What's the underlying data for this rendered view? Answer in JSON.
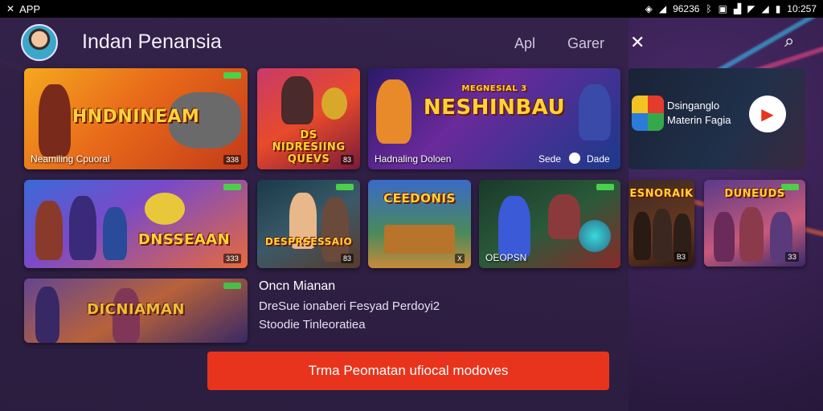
{
  "status_bar": {
    "left_icon": "app-indicator-icon",
    "left_label": "APP",
    "signal_value": "96236",
    "time": "10:257"
  },
  "header": {
    "title": "Indan Penansia",
    "links": [
      "Apl",
      "Garer"
    ],
    "search_icon": "search-icon"
  },
  "tiles": [
    {
      "title": "HNDNINEAM",
      "caption": "Neamiling Cpuoral",
      "num": "ЗЗ8"
    },
    {
      "title": "DS NIDRESIING QUEVS",
      "caption": "",
      "num": "83"
    },
    {
      "title": "NESHINBAU",
      "subtitle": "MEGNESIAL 3",
      "caption": "Hadnaling Doloen",
      "right_label": "Sede",
      "right_label2": "Dade"
    },
    {
      "title": "",
      "caption": "",
      "num": ""
    },
    {
      "title": "DNSSEAAN",
      "caption": "",
      "num": "3ЗЗ"
    },
    {
      "title": "DESPRSESSAIO",
      "caption": "",
      "num": "83"
    },
    {
      "title": "CEEDONIS",
      "caption": "",
      "num": "X"
    },
    {
      "title": "",
      "caption": "OEOPSN",
      "num": ""
    },
    {
      "title": "DICNIAMAN",
      "caption": "",
      "num": ""
    }
  ],
  "side_tiles": [
    {
      "title": "ESNORAIK",
      "num": "ВЗ"
    },
    {
      "title": "DUNEUDS",
      "num": "ЗЗ"
    }
  ],
  "side_card": {
    "line1": "Dsinganglo",
    "line2": "Materin Fagia"
  },
  "info": {
    "title": "Oncn Mianan",
    "line1": "DreSue ionaberi Fesyad Perdoyi2",
    "line2": "Stoodie Tinleoratiea"
  },
  "cta_label": "Trma Peomatan ufiocal modoves",
  "colors": {
    "accent": "#e8341c",
    "panel": "#34224a",
    "title_text": "#ffd23a"
  }
}
